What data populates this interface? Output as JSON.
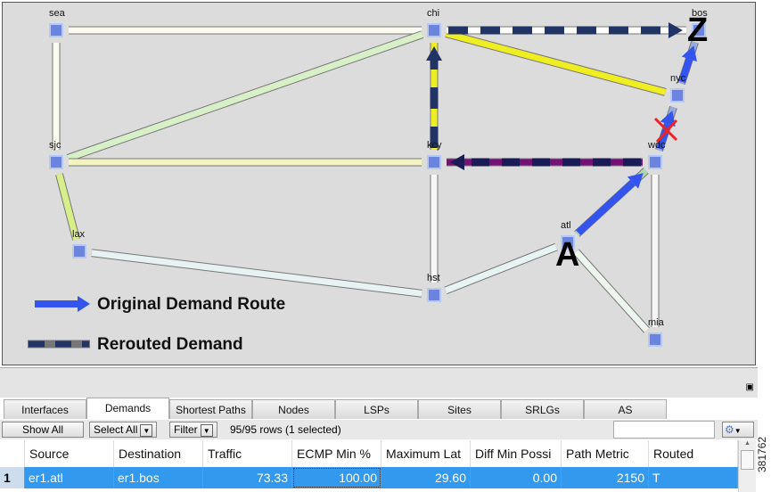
{
  "map": {
    "nodes": [
      {
        "id": "sea",
        "label": "sea"
      },
      {
        "id": "chi",
        "label": "chi"
      },
      {
        "id": "bos",
        "label": "bos"
      },
      {
        "id": "nyc",
        "label": "nyc"
      },
      {
        "id": "sjc",
        "label": "sjc"
      },
      {
        "id": "kcy",
        "label": "kcy"
      },
      {
        "id": "wdc",
        "label": "wdc"
      },
      {
        "id": "lax",
        "label": "lax"
      },
      {
        "id": "atl",
        "label": "atl"
      },
      {
        "id": "hst",
        "label": "hst"
      },
      {
        "id": "mia",
        "label": "mia"
      }
    ],
    "source_marker": "A",
    "dest_marker": "Z",
    "legend": {
      "original": "Original Demand Route",
      "rerouted": "Rerouted Demand"
    },
    "colors": {
      "original": "#3355ee",
      "rerouted": "#223366",
      "failed": "#ee2222"
    }
  },
  "tabs": [
    "Interfaces",
    "Demands",
    "Shortest Paths",
    "Nodes",
    "LSPs",
    "Sites",
    "SRLGs",
    "AS"
  ],
  "active_tab": "Demands",
  "toolbar": {
    "show_all": "Show All",
    "select_all": "Select All",
    "filter": "Filter",
    "rows_status": "95/95 rows (1 selected)",
    "search_value": ""
  },
  "table": {
    "columns": [
      "Source",
      "Destination",
      "Traffic",
      "ECMP Min %",
      "Maximum Lat",
      "Diff Min Possi",
      "Path Metric",
      "Routed"
    ],
    "rows": [
      {
        "index": "1",
        "cells": [
          "er1.atl",
          "er1.bos",
          "73.33",
          "100.00",
          "29.60",
          "0.00",
          "2150",
          "T"
        ]
      }
    ]
  },
  "watermark": "381762"
}
